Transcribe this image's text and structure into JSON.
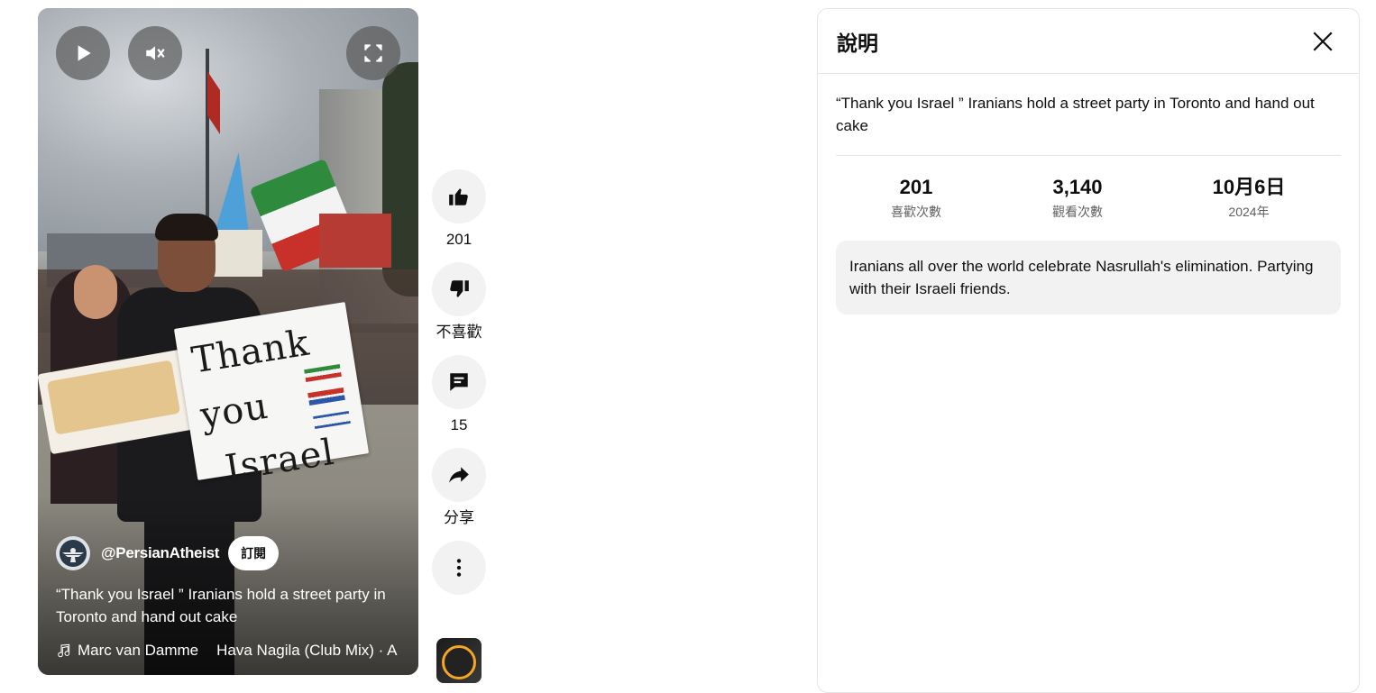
{
  "player": {
    "channel_handle": "@PersianAtheist",
    "subscribe_label": "訂閱",
    "title": "“Thank you Israel ” Iranians hold a street party in Toronto and hand out cake",
    "music_artist": "Marc van Damme",
    "music_track": "Hava Nagila (Club Mix) · A",
    "sign_line1": "Thank you",
    "sign_line2": "Israel",
    "controls": {
      "play_icon": "play-icon",
      "mute_icon": "muted-icon",
      "fullscreen_icon": "fullscreen-icon"
    }
  },
  "actions": {
    "like_count": "201",
    "dislike_label": "不喜歡",
    "comment_count": "15",
    "share_label": "分享"
  },
  "description_panel": {
    "title": "說明",
    "video_title": "“Thank you Israel ” Iranians hold a street party in Toronto and hand out cake",
    "stats": [
      {
        "value": "201",
        "label": "喜歡次數"
      },
      {
        "value": "3,140",
        "label": "觀看次數"
      },
      {
        "value": "10月6日",
        "label": "2024年"
      }
    ],
    "description": "Iranians all over the world celebrate Nasrullah's elimination. Partying with their Israeli friends."
  },
  "colors": {
    "accent_bg": "#f2f2f2",
    "text": "#0f0f0f",
    "secondary_text": "#606060"
  }
}
